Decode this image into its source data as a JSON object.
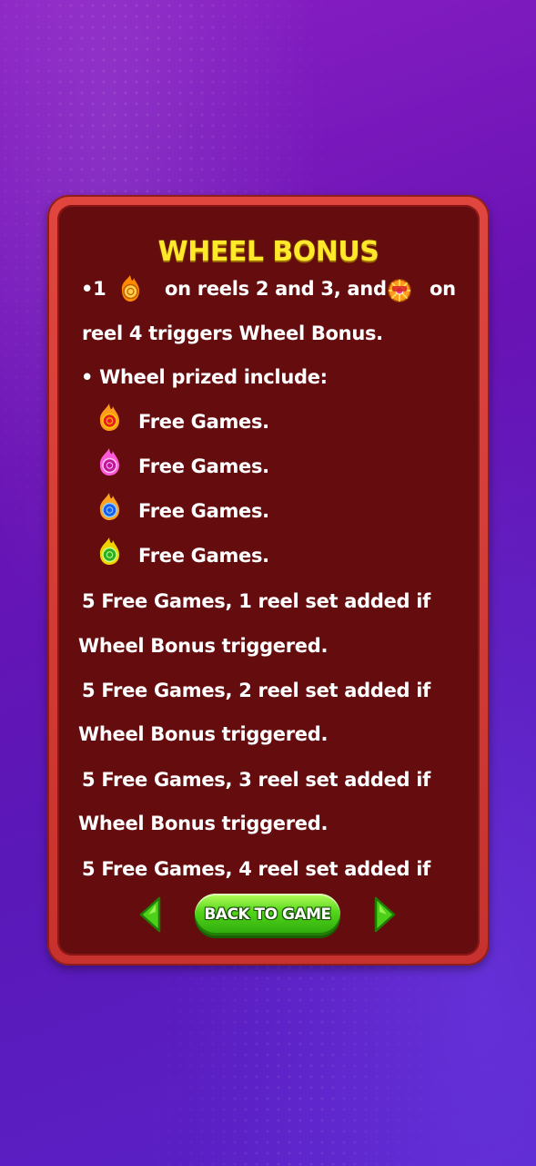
{
  "panel": {
    "title": "WHEEL BONUS",
    "lines": [
      "•1",
      "on reels 2 and 3, and",
      "on",
      "reel 4 triggers Wheel Bonus.",
      "• Wheel prized include:",
      "Free Games.",
      "Free Games.",
      "Free Games.",
      "Free Games.",
      "5 Free Games, 1 reel set added if",
      "Wheel Bonus triggered.",
      "5 Free Games, 2 reel set added if",
      "Wheel Bonus triggered.",
      "5 Free Games, 3 reel set added if",
      "Wheel Bonus triggered.",
      "5 Free Games, 4 reel set added if"
    ],
    "icons": [
      "fireball-orange-icon",
      "wheel-bonus-icon",
      "fireball-red-icon",
      "fireball-pink-icon",
      "fireball-blue-icon",
      "fireball-green-icon"
    ]
  },
  "nav": {
    "back_label": "BACK TO GAME",
    "prev_icon": "arrow-left-icon",
    "next_icon": "arrow-right-icon"
  },
  "colors": {
    "title": "#ffe92a",
    "panel_border": "#d93c36",
    "panel_bg": "#650d0e",
    "button": "#4cd018"
  }
}
